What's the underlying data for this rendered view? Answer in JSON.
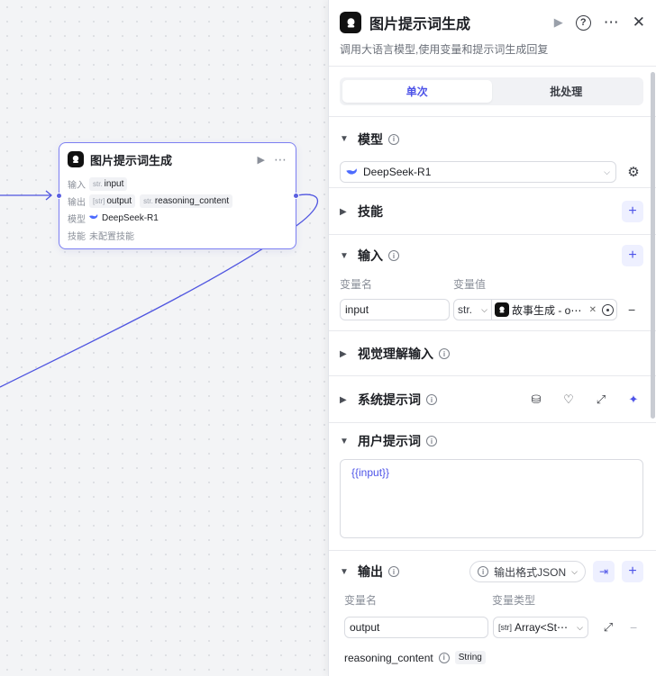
{
  "node": {
    "title": "图片提示词生成",
    "input_label": "输入",
    "input_type": "str.",
    "input_name": "input",
    "output_label": "输出",
    "output_type1": "[str]",
    "output_name1": "output",
    "output_type2": "str.",
    "output_name2": "reasoning_content",
    "model_label": "模型",
    "model_name": "DeepSeek-R1",
    "skill_label": "技能",
    "skill_value": "未配置技能"
  },
  "panel": {
    "title": "图片提示词生成",
    "description": "调用大语言模型,使用变量和提示词生成回复",
    "tabs": [
      "单次",
      "批处理"
    ],
    "model": {
      "title": "模型",
      "value": "DeepSeek-R1"
    },
    "skills": {
      "title": "技能"
    },
    "input": {
      "title": "输入",
      "col_name": "变量名",
      "col_value": "变量值",
      "var_name": "input",
      "var_type": "str.",
      "ref_value": "故事生成 - o⋯"
    },
    "vision": {
      "title": "视觉理解输入"
    },
    "system_prompt": {
      "title": "系统提示词"
    },
    "user_prompt": {
      "title": "用户提示词",
      "content": "{{input}}"
    },
    "output": {
      "title": "输出",
      "format_label": "输出格式JSON",
      "col_name": "变量名",
      "col_type": "变量类型",
      "var_name": "output",
      "var_type_tag": "[str]",
      "var_type": "Array<St⋯",
      "reasoning_name": "reasoning_content",
      "reasoning_type": "String"
    }
  },
  "colors": {
    "accent": "#4d53e8",
    "wire": "#4f55e0",
    "node_border": "#7c7ff2"
  }
}
